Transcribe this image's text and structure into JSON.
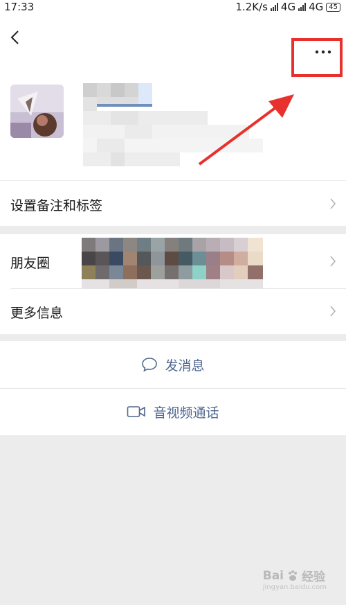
{
  "status_bar": {
    "time": "17:33",
    "speed": "1.2K/s",
    "network_1": "4G",
    "network_2": "4G",
    "battery": "45"
  },
  "profile": {
    "avatar": "profile-avatar"
  },
  "menu": {
    "set_remark_tags": "设置备注和标签",
    "moments": "朋友圈",
    "more_info": "更多信息"
  },
  "actions": {
    "send_message": "发消息",
    "video_call": "音视频通话"
  },
  "watermark": {
    "brand": "Bai",
    "brand_cn": "经验",
    "sub": "jingyan.baidu.com"
  },
  "colors": {
    "highlight": "#e8312d",
    "action_text": "#4f6690"
  }
}
